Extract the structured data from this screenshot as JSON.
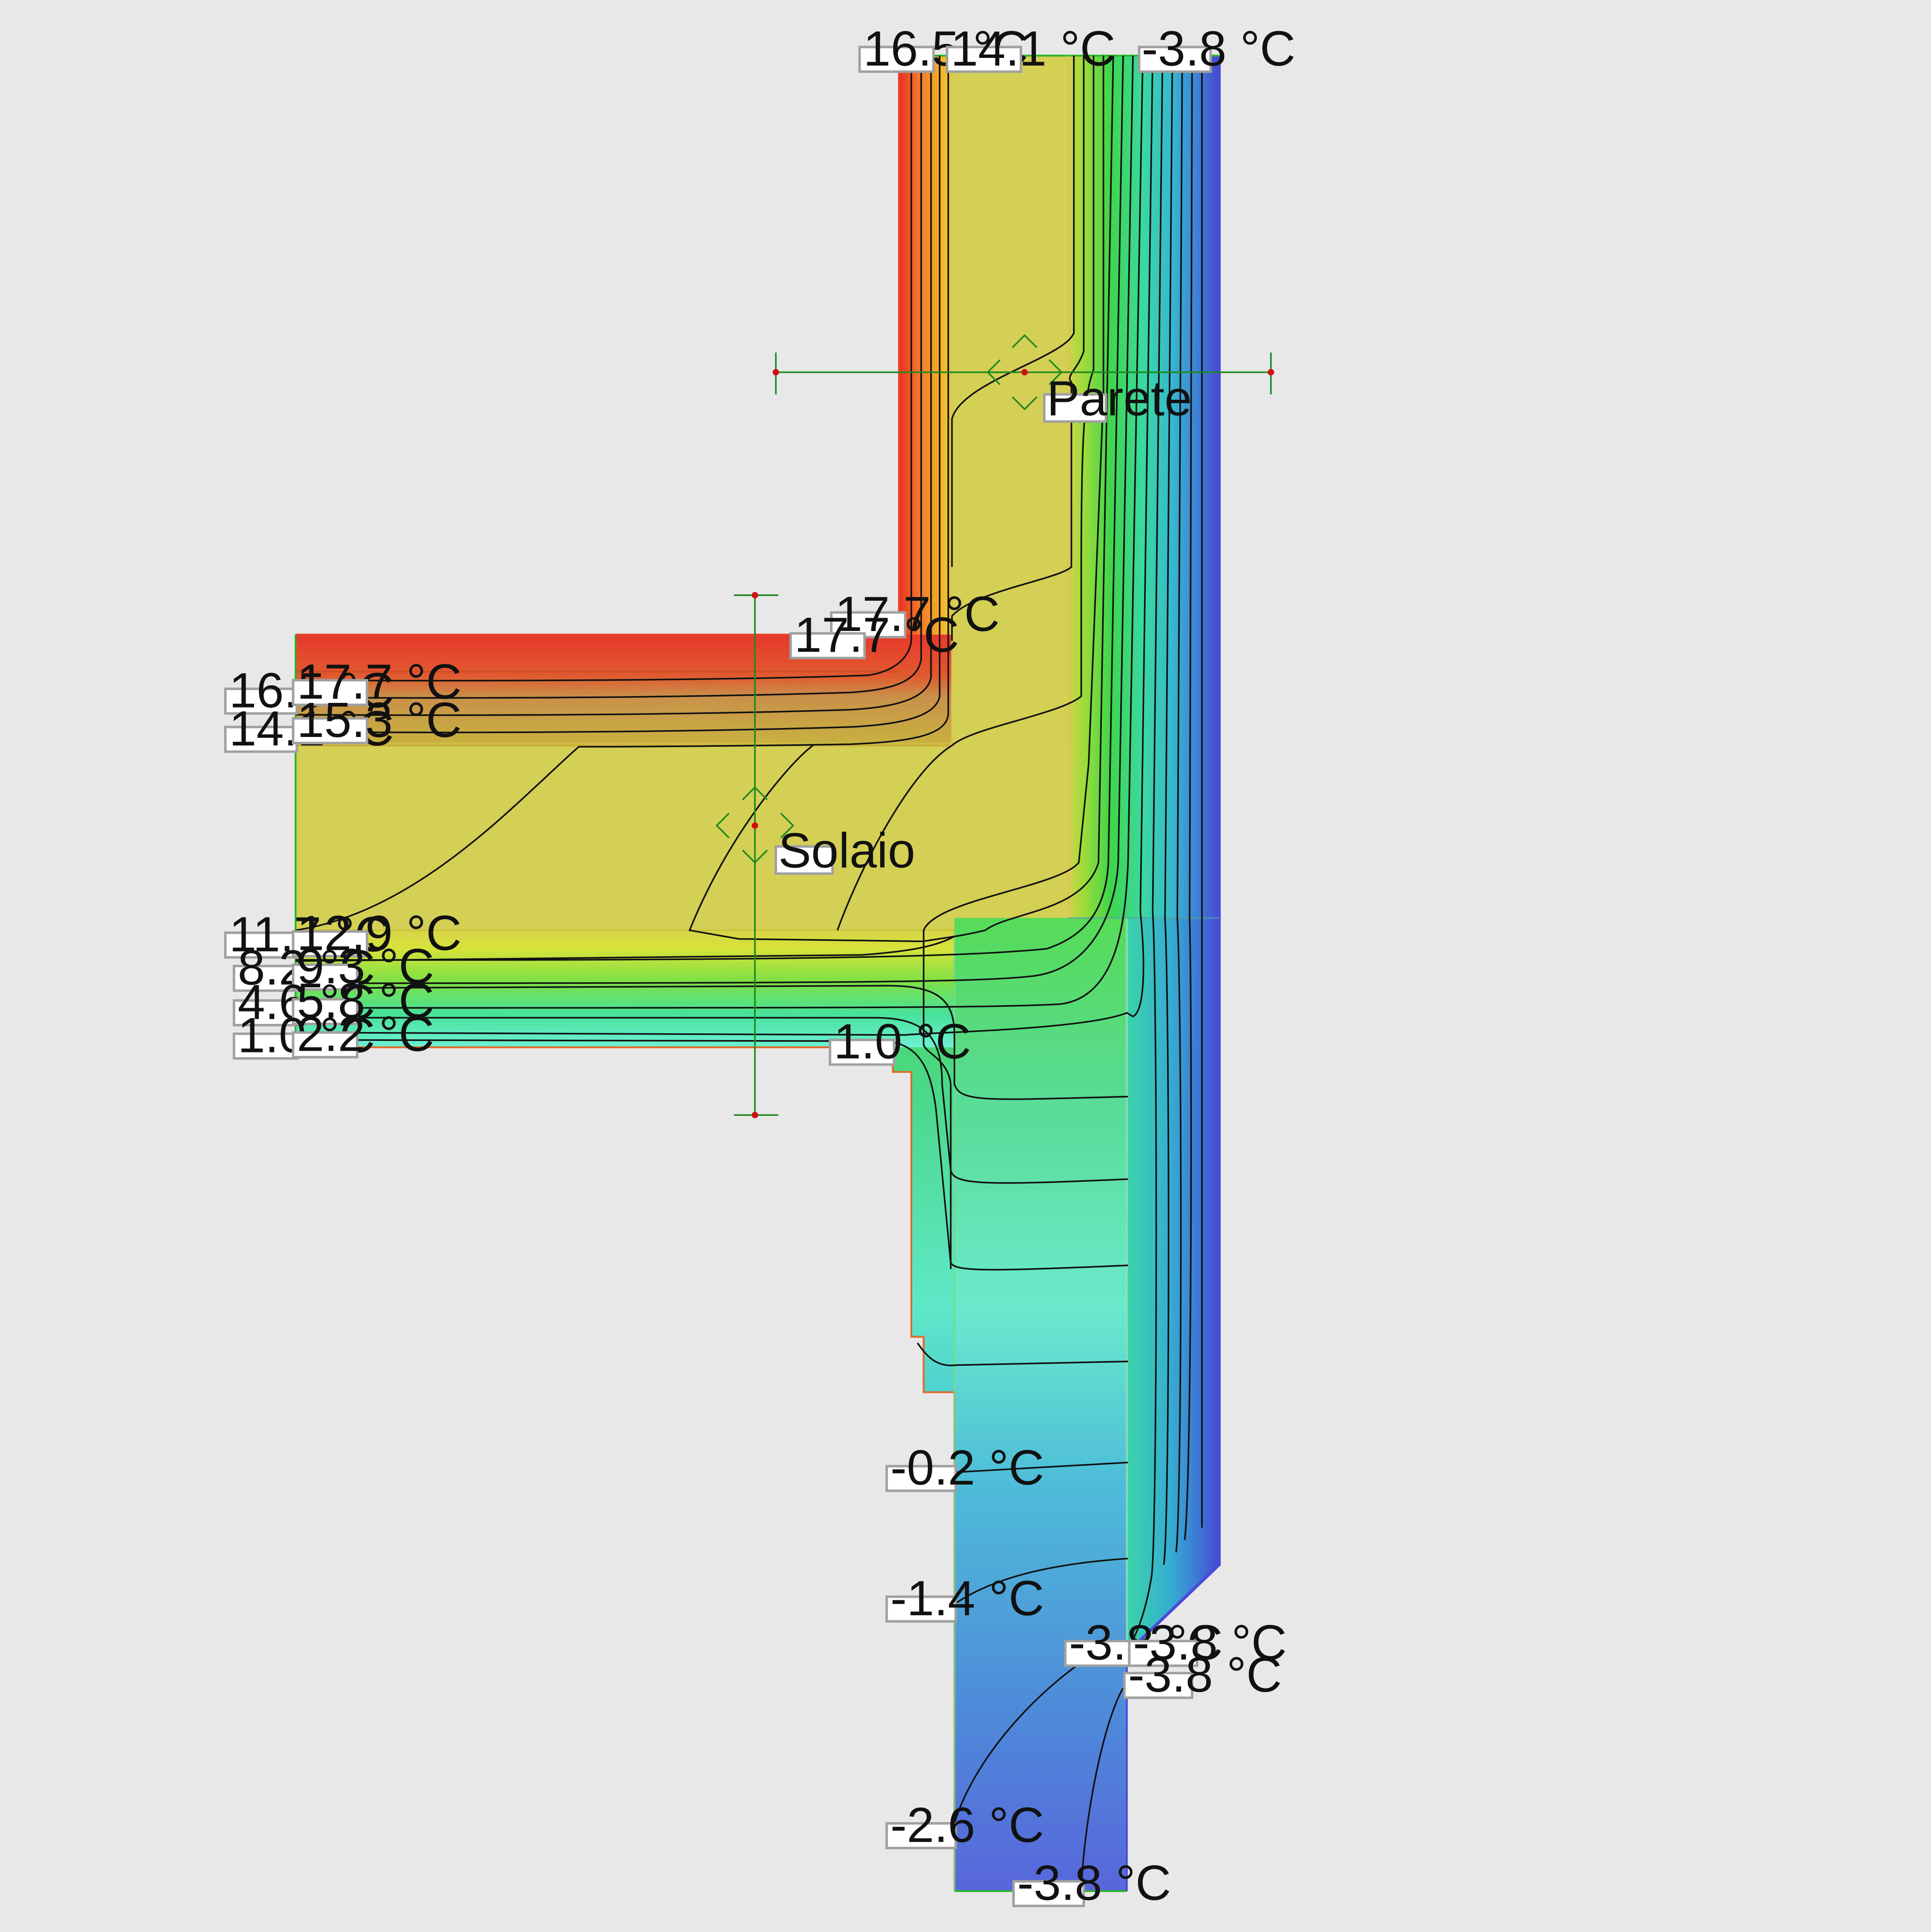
{
  "colors": {
    "background": "#e8e8e8",
    "hot": "#e83020",
    "warm": "#f7a21a",
    "mid_yellow": "#d8d850",
    "green": "#39d64a",
    "cyan": "#5ee8c8",
    "blue": "#4a6ad8",
    "cold": "#4848d0",
    "isotherm": "#111111",
    "axis_line": "#1f8a1f",
    "axis_point": "#d01010"
  },
  "markers": [
    {
      "name": "Parete",
      "icon": "move-arrows-icon"
    },
    {
      "name": "Solaio",
      "icon": "move-arrows-icon"
    }
  ],
  "labels": [
    {
      "id": "wall-top-interior",
      "text": "16.5  °C"
    },
    {
      "id": "wall-top-inner",
      "text": "14.1  °C"
    },
    {
      "id": "wall-top-exterior",
      "text": "-3.8  °C"
    },
    {
      "id": "floor-top-corner-a",
      "text": "17.7  °C"
    },
    {
      "id": "floor-top-corner-b",
      "text": "17.7  °C"
    },
    {
      "id": "floor-left-a-outer",
      "text": "16.5  °C"
    },
    {
      "id": "floor-left-a-inner",
      "text": "17.7  °C"
    },
    {
      "id": "floor-left-b-outer",
      "text": "14.1  °C"
    },
    {
      "id": "floor-left-b-inner",
      "text": "15.3  °C"
    },
    {
      "id": "floor-left-c-outer",
      "text": "11.7  °C"
    },
    {
      "id": "floor-left-c-inner",
      "text": "12.9  °C"
    },
    {
      "id": "floor-left-d-outer",
      "text": "8.2  °C"
    },
    {
      "id": "floor-left-d-inner",
      "text": "9.3  °C"
    },
    {
      "id": "floor-left-e-outer",
      "text": "4.6  °C"
    },
    {
      "id": "floor-left-e-inner",
      "text": "5.8  °C"
    },
    {
      "id": "floor-left-f-outer",
      "text": "1.0  °C"
    },
    {
      "id": "floor-left-f-inner",
      "text": "2.2  °C"
    },
    {
      "id": "floor-bottom-corner",
      "text": "1.0  °C"
    },
    {
      "id": "lower-wall-a",
      "text": "-0.2  °C"
    },
    {
      "id": "lower-wall-b",
      "text": "-1.4  °C"
    },
    {
      "id": "lower-wall-c",
      "text": "-2.6  °C"
    },
    {
      "id": "lower-right-a",
      "text": "-3.8  °C"
    },
    {
      "id": "lower-right-b",
      "text": "-3.8  °C"
    },
    {
      "id": "lower-right-c",
      "text": "-3.8  °C"
    },
    {
      "id": "bottom-exterior",
      "text": "-3.8  °C"
    }
  ]
}
